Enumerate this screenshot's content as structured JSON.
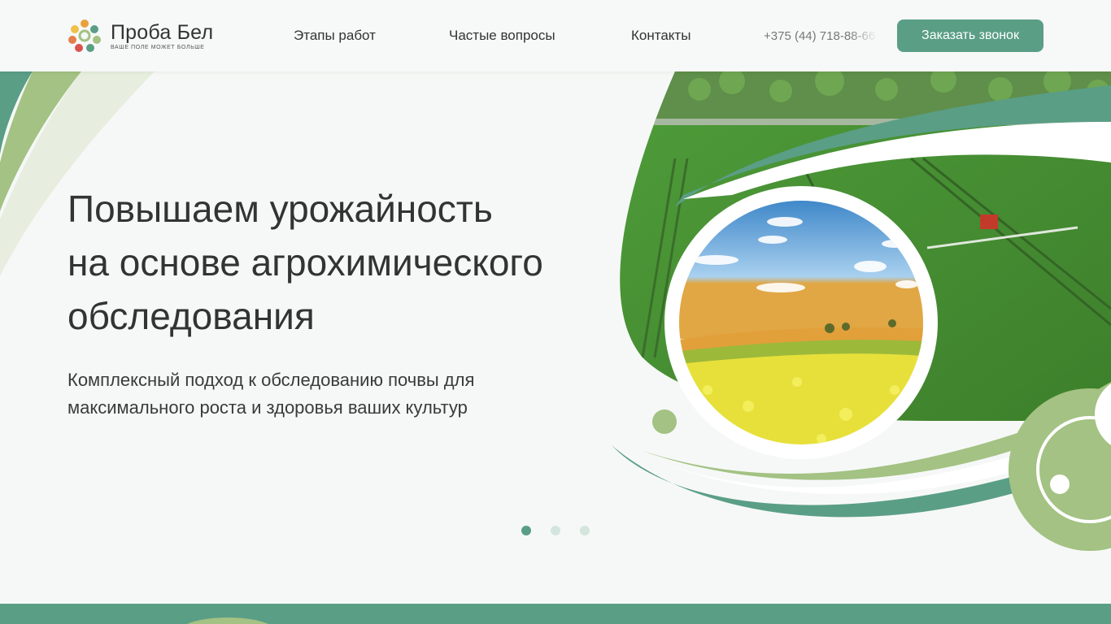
{
  "header": {
    "logo": {
      "name": "Проба Бел",
      "slogan": "ВАШЕ ПОЛЕ МОЖЕТ БОЛЬШЕ"
    },
    "nav": [
      {
        "label": "Этапы работ"
      },
      {
        "label": "Частые вопросы"
      },
      {
        "label": "Контакты"
      }
    ],
    "phone": "+375 (44) 718-88-66",
    "cta_label": "Заказать звонок"
  },
  "hero": {
    "title_lines": [
      "Повышаем урожайность",
      "на основе агрохимического",
      "обследования"
    ],
    "subtitle_lines": [
      "Комплексный подход к обследованию почвы для",
      "максимального роста и здоровья ваших культур"
    ],
    "slides": {
      "count": 3,
      "active": 1
    }
  },
  "colors": {
    "accent": "#5a9e86",
    "light_green": "#a3c283",
    "background": "#f6f8f7"
  },
  "icons": [
    "logo-mark-icon"
  ]
}
